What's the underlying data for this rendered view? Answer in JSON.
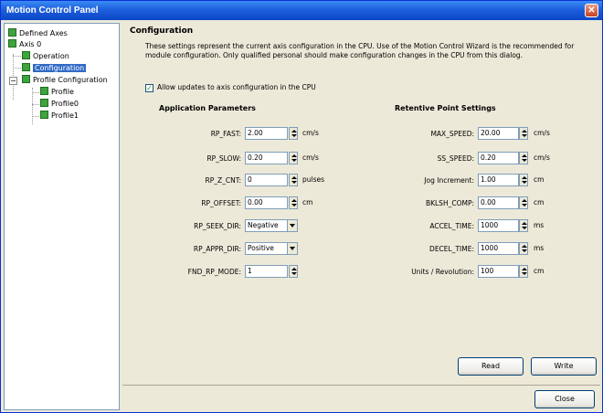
{
  "window": {
    "title": "Motion Control Panel"
  },
  "tree": {
    "items": [
      {
        "label": "Defined Axes"
      },
      {
        "label": "Axis 0"
      },
      {
        "label": "Operation"
      },
      {
        "label": "Configuration"
      },
      {
        "label": "Profile Configuration"
      },
      {
        "label": "Profile"
      },
      {
        "label": "Profile0"
      },
      {
        "label": "Profile1"
      }
    ]
  },
  "config": {
    "title": "Configuration",
    "description": "These settings represent the current axis configuration in the CPU. Use of the Motion Control Wizard is the recommended for module configuration.  Only qualified personal should make configuration changes in the CPU from this dialog.",
    "allow_updates_label": "Allow updates to axis configuration in the CPU",
    "app_params": {
      "title": "Application Parameters",
      "rows": [
        {
          "label": "RP_FAST:",
          "value": "2.00",
          "unit": "cm/s"
        },
        {
          "label": "RP_SLOW:",
          "value": "0.20",
          "unit": "cm/s"
        },
        {
          "label": "RP_Z_CNT:",
          "value": "0",
          "unit": "pulses"
        },
        {
          "label": "RP_OFFSET:",
          "value": "0.00",
          "unit": "cm"
        },
        {
          "label": "RP_SEEK_DIR:",
          "value": "Negative",
          "unit": ""
        },
        {
          "label": "RP_APPR_DIR:",
          "value": "Positive",
          "unit": ""
        },
        {
          "label": "FND_RP_MODE:",
          "value": "1",
          "unit": ""
        }
      ]
    },
    "retentive": {
      "title": "Retentive Point Settings",
      "rows": [
        {
          "label": "MAX_SPEED:",
          "value": "20.00",
          "unit": "cm/s"
        },
        {
          "label": "SS_SPEED:",
          "value": "0.20",
          "unit": "cm/s"
        },
        {
          "label": "Jog Increment:",
          "value": "1.00",
          "unit": "cm"
        },
        {
          "label": "BKLSH_COMP:",
          "value": "0.00",
          "unit": "cm"
        },
        {
          "label": "ACCEL_TIME:",
          "value": "1000",
          "unit": "ms"
        },
        {
          "label": "DECEL_TIME:",
          "value": "1000",
          "unit": "ms"
        },
        {
          "label": "Units / Revolution:",
          "value": "100",
          "unit": "cm"
        }
      ]
    }
  },
  "buttons": {
    "read": "Read",
    "write": "Write",
    "close": "Close"
  },
  "icons": {
    "close": "✕",
    "check": "✓",
    "collapse": "−"
  }
}
